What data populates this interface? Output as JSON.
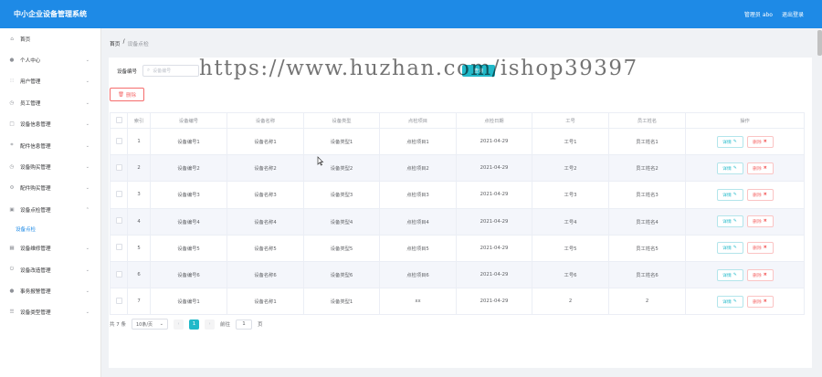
{
  "app": {
    "title": "中小企业设备管理系统"
  },
  "topbar": {
    "user_label": "管理员 abo",
    "logout_label": "退出登录"
  },
  "sidebar": {
    "items": [
      {
        "label": "首页",
        "icon": "home-icon",
        "has_arrow": false
      },
      {
        "label": "个人中心",
        "icon": "user-icon",
        "has_arrow": true
      },
      {
        "label": "用户管理",
        "icon": "users-icon",
        "has_arrow": true
      },
      {
        "label": "员工管理",
        "icon": "clock-icon",
        "has_arrow": true
      },
      {
        "label": "设备信息管理",
        "icon": "lock-icon",
        "has_arrow": true
      },
      {
        "label": "配件信息管理",
        "icon": "crop-icon",
        "has_arrow": true
      },
      {
        "label": "设备购买管理",
        "icon": "clock-icon",
        "has_arrow": true
      },
      {
        "label": "配件购买管理",
        "icon": "settings-icon",
        "has_arrow": true
      },
      {
        "label": "设备点检管理",
        "icon": "box-icon",
        "has_arrow": true,
        "expanded": true
      },
      {
        "label": "设备维修管理",
        "icon": "grid-icon",
        "has_arrow": true
      },
      {
        "label": "设备改造管理",
        "icon": "power-icon",
        "has_arrow": true
      },
      {
        "label": "事务报警管理",
        "icon": "user-icon",
        "has_arrow": true
      },
      {
        "label": "设备类型管理",
        "icon": "list-icon",
        "has_arrow": true
      }
    ],
    "submenu": {
      "label": "设备点检"
    }
  },
  "breadcrumb": {
    "home": "首页",
    "separator": "/",
    "current": "设备点检"
  },
  "search": {
    "label": "设备编号",
    "placeholder": "设备编号",
    "query_label": "查询"
  },
  "watermark": "https://www.huzhan.com/ishop39397",
  "delete_button": {
    "label": "删除"
  },
  "table": {
    "headers": [
      "索引",
      "设备编号",
      "设备名称",
      "设备类型",
      "点检项目",
      "点检日期",
      "工号",
      "员工姓名",
      "操作"
    ],
    "rows": [
      [
        "1",
        "设备编号1",
        "设备名称1",
        "设备类型1",
        "点检项目1",
        "2021-04-29",
        "工号1",
        "员工姓名1"
      ],
      [
        "2",
        "设备编号2",
        "设备名称2",
        "设备类型2",
        "点检项目2",
        "2021-04-29",
        "工号2",
        "员工姓名2"
      ],
      [
        "3",
        "设备编号3",
        "设备名称3",
        "设备类型3",
        "点检项目3",
        "2021-04-29",
        "工号3",
        "员工姓名3"
      ],
      [
        "4",
        "设备编号4",
        "设备名称4",
        "设备类型4",
        "点检项目4",
        "2021-04-29",
        "工号4",
        "员工姓名4"
      ],
      [
        "5",
        "设备编号5",
        "设备名称5",
        "设备类型5",
        "点检项目5",
        "2021-04-29",
        "工号5",
        "员工姓名5"
      ],
      [
        "6",
        "设备编号6",
        "设备名称6",
        "设备类型6",
        "点检项目6",
        "2021-04-29",
        "工号6",
        "员工姓名6"
      ],
      [
        "7",
        "设备编号1",
        "设备名称1",
        "设备类型1",
        "xx",
        "2021-04-29",
        "2",
        "2"
      ]
    ],
    "detail_label": "详情",
    "delete_label": "删除"
  },
  "pagination": {
    "total": "共 7 条",
    "page_size": "10条/页",
    "current_page": "1",
    "goto_prefix": "前往",
    "goto_value": "1",
    "goto_suffix": "页"
  },
  "colors": {
    "primary": "#1e8ae6",
    "accent": "#21b9c9",
    "danger": "#f56c6c"
  }
}
